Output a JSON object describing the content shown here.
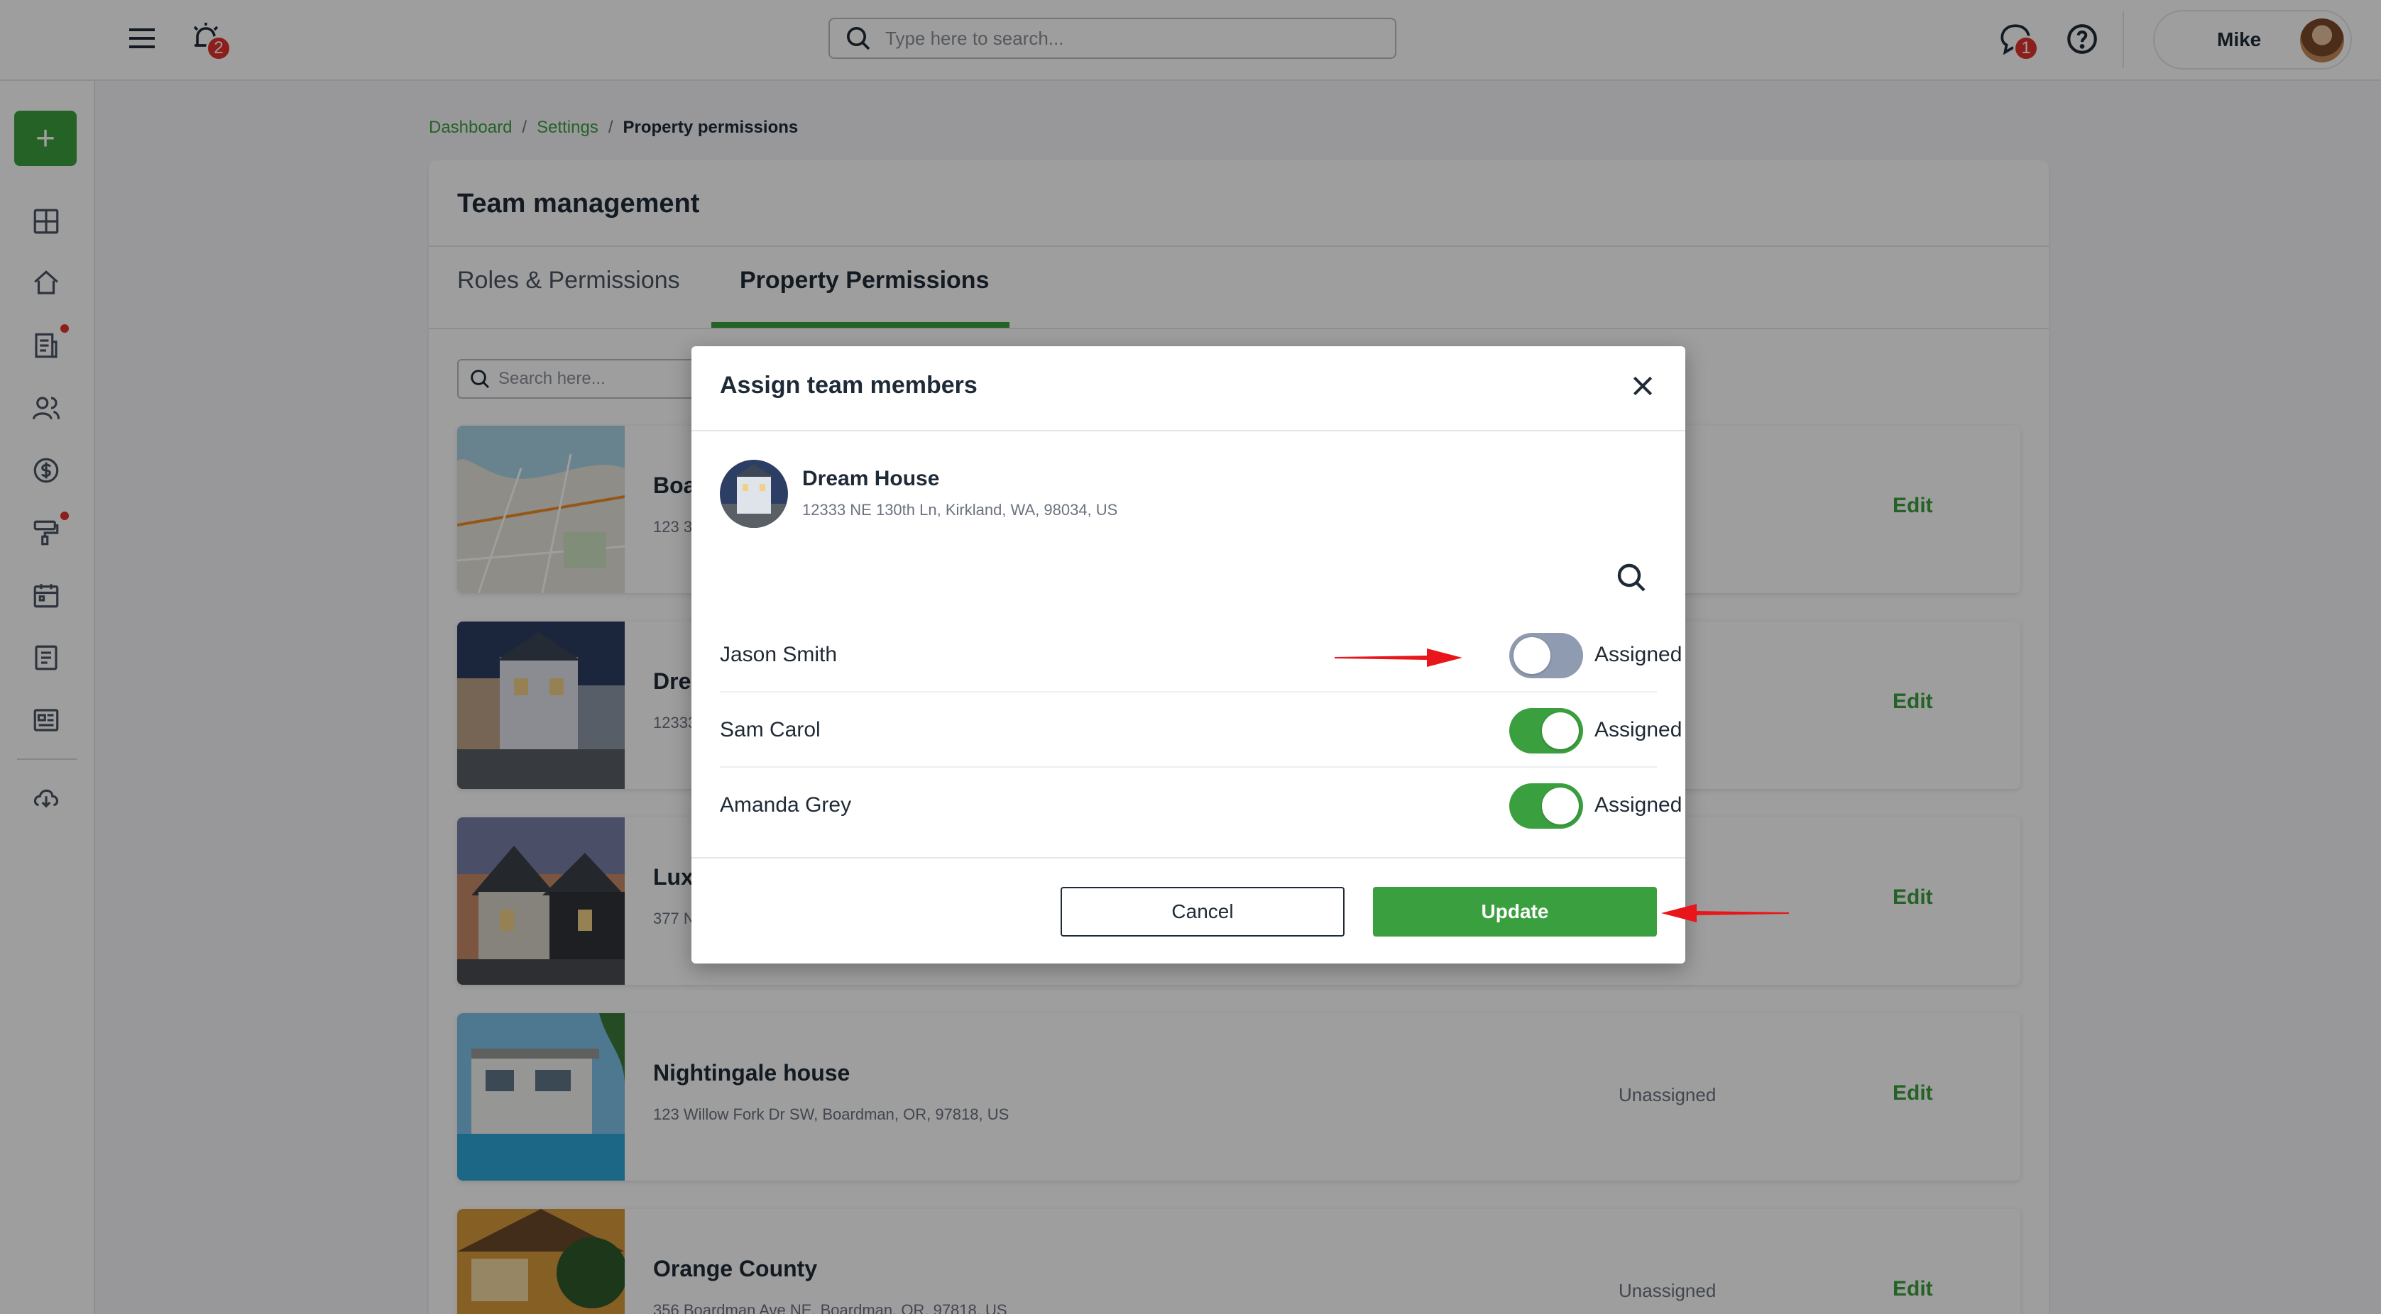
{
  "topbar": {
    "notification_count": "2",
    "search_placeholder": "Type here to search...",
    "chat_count": "1",
    "user_name": "Mike"
  },
  "sidebar": {
    "add_button": "+",
    "items": [
      {
        "icon": "dashboard-icon"
      },
      {
        "icon": "home-icon"
      },
      {
        "icon": "document-icon",
        "dot": true
      },
      {
        "icon": "users-icon"
      },
      {
        "icon": "dollar-icon"
      },
      {
        "icon": "paint-roller-icon",
        "dot": true
      },
      {
        "icon": "calendar-icon"
      },
      {
        "icon": "file-icon"
      },
      {
        "icon": "newspaper-icon"
      },
      {
        "icon": "cloud-download-icon"
      }
    ]
  },
  "breadcrumb": {
    "items": [
      "Dashboard",
      "Settings"
    ],
    "current": "Property permissions",
    "separator": "/"
  },
  "card": {
    "title": "Team management",
    "tabs": [
      "Roles & Permissions",
      "Property Permissions"
    ],
    "active_tab": "Property Permissions",
    "search_placeholder": "Search here..."
  },
  "properties": [
    {
      "name": "Boa",
      "address": "123 3",
      "status": "",
      "edit": "Edit"
    },
    {
      "name": "Dre",
      "address": "12333",
      "status": "",
      "edit": "Edit"
    },
    {
      "name": "Lux",
      "address": "377 N",
      "status": "",
      "edit": "Edit"
    },
    {
      "name": "Nightingale house",
      "address": "123 Willow Fork Dr SW, Boardman, OR, 97818, US",
      "status": "Unassigned",
      "edit": "Edit"
    },
    {
      "name": "Orange County",
      "address": "356 Boardman Ave NE, Boardman, OR, 97818, US",
      "status": "Unassigned",
      "edit": "Edit"
    }
  ],
  "modal": {
    "title": "Assign team members",
    "property_name": "Dream House",
    "property_address": "12333 NE 130th Ln, Kirkland, WA, 98034, US",
    "members": [
      {
        "name": "Jason Smith",
        "assigned": false,
        "status": "Assigned"
      },
      {
        "name": "Sam Carol",
        "assigned": true,
        "status": "Assigned"
      },
      {
        "name": "Amanda Grey",
        "assigned": true,
        "status": "Assigned"
      }
    ],
    "cancel_label": "Cancel",
    "update_label": "Update"
  },
  "colors": {
    "accent": "#3a9f3e",
    "badge": "#e0322d",
    "annotation_arrow": "#e8161b"
  }
}
